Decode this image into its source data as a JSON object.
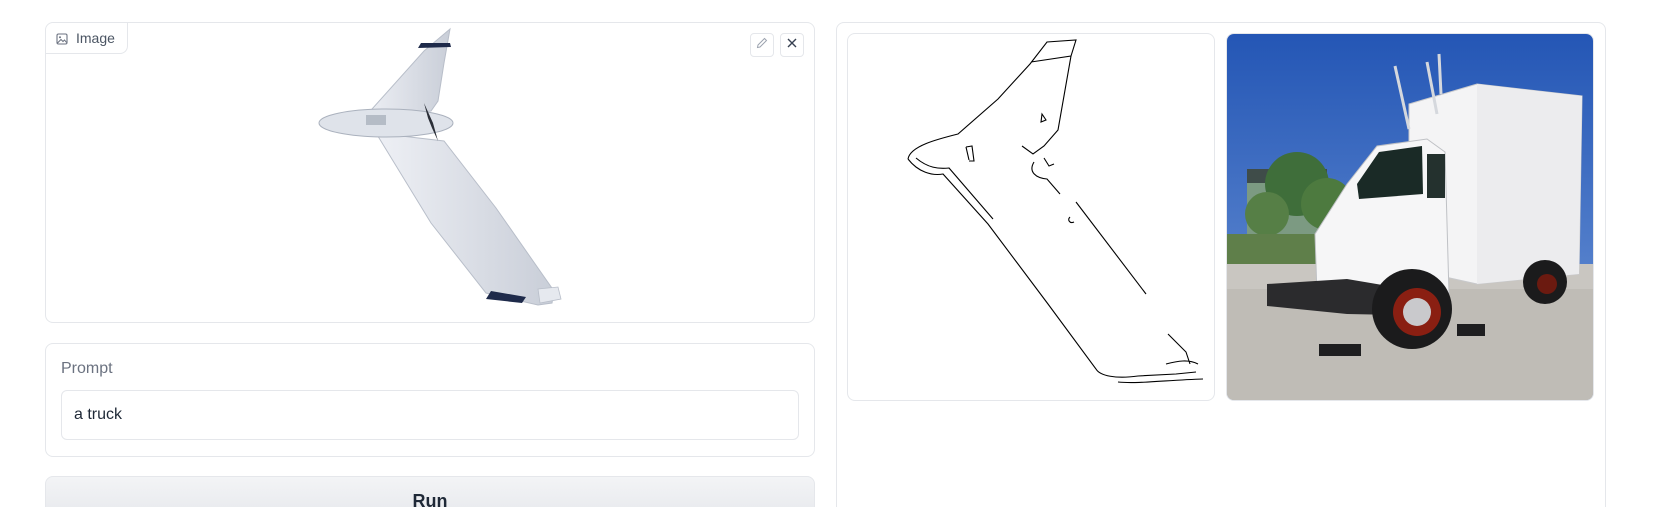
{
  "input_image": {
    "label": "Image",
    "label_icon": "image-icon",
    "edit_icon": "pencil-icon",
    "clear_icon": "close-icon"
  },
  "prompt": {
    "label": "Prompt",
    "value": "a truck"
  },
  "run_button": {
    "label": "Run"
  },
  "gallery": {
    "items": [
      {
        "icon": "edge-map-image"
      },
      {
        "icon": "truck-image"
      }
    ]
  },
  "colors": {
    "border": "#e5e7eb",
    "label_text": "#6b7280",
    "sky": "#2f63c2",
    "drone_body": "#e6e9ef"
  }
}
